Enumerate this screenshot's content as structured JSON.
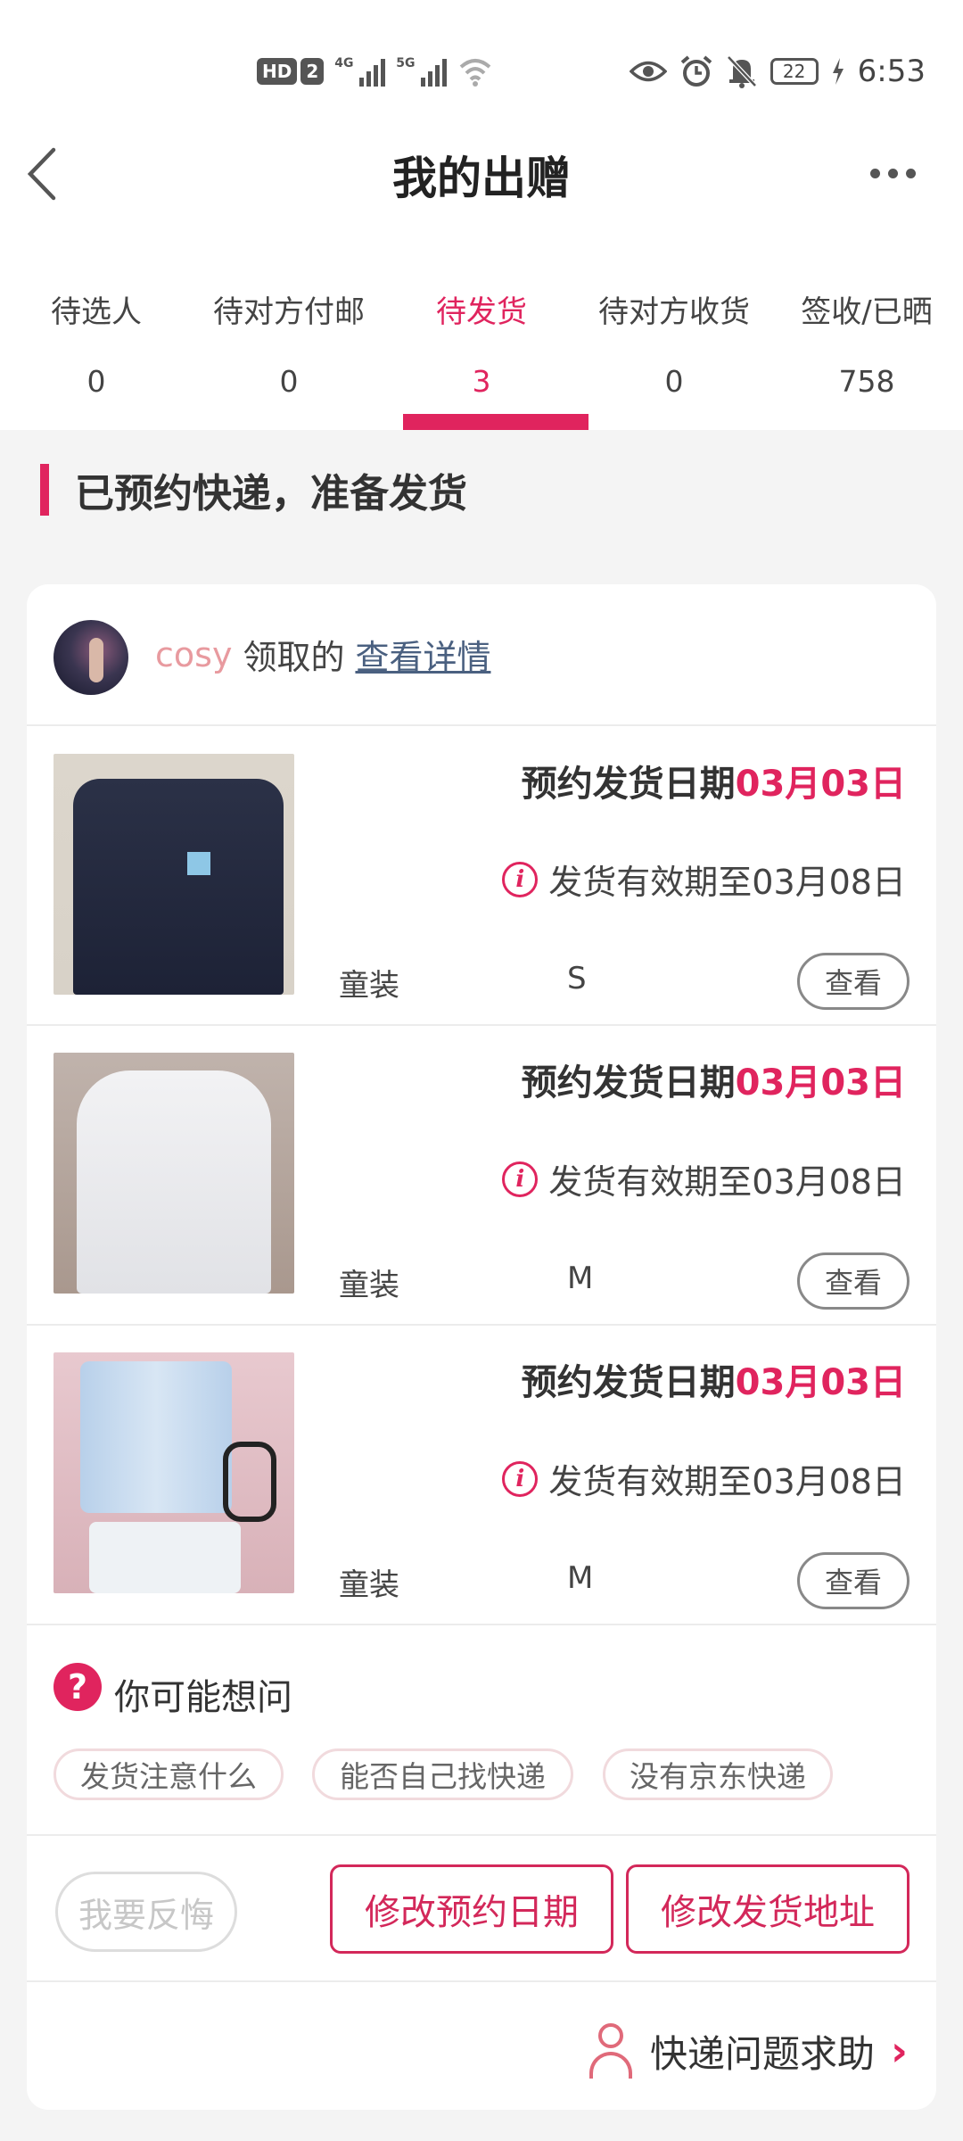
{
  "status_bar": {
    "hd_label": "HD",
    "sim_label": "2",
    "net1_label": "4G",
    "net2_label": "5G",
    "battery": "22",
    "time": "6:53"
  },
  "header": {
    "title": "我的出赠",
    "back_icon": "chevron-left-icon",
    "more_icon": "more-dots-icon"
  },
  "tabs": [
    {
      "label": "待选人",
      "count": "0"
    },
    {
      "label": "待对方付邮",
      "count": "0"
    },
    {
      "label": "待发货",
      "count": "3",
      "active": true
    },
    {
      "label": "待对方收货",
      "count": "0"
    },
    {
      "label": "签收/已晒",
      "count": "758"
    }
  ],
  "section": {
    "title": "已预约快递，准备发货"
  },
  "order": {
    "owner_name": "cosy",
    "owner_action": "领取的",
    "detail_link": "查看详情",
    "items": [
      {
        "date_label": "预约发货日期",
        "date_value": "03月03日",
        "valid_text": "发货有效期至03月08日",
        "category": "童装",
        "size": "S",
        "view_label": "查看"
      },
      {
        "date_label": "预约发货日期",
        "date_value": "03月03日",
        "valid_text": "发货有效期至03月08日",
        "category": "童装",
        "size": "M",
        "view_label": "查看"
      },
      {
        "date_label": "预约发货日期",
        "date_value": "03月03日",
        "valid_text": "发货有效期至03月08日",
        "category": "童装",
        "size": "M",
        "view_label": "查看"
      }
    ]
  },
  "faq": {
    "title": "你可能想问",
    "questions": [
      "发货注意什么",
      "能否自己找快递",
      "没有京东快递"
    ]
  },
  "actions": {
    "regret": "我要反悔",
    "change_date": "修改预约日期",
    "change_address": "修改发货地址"
  },
  "help": {
    "label": "快递问题求助"
  },
  "colors": {
    "accent": "#e0245e",
    "link": "#4a6080",
    "owner_name": "#e89a9f"
  }
}
